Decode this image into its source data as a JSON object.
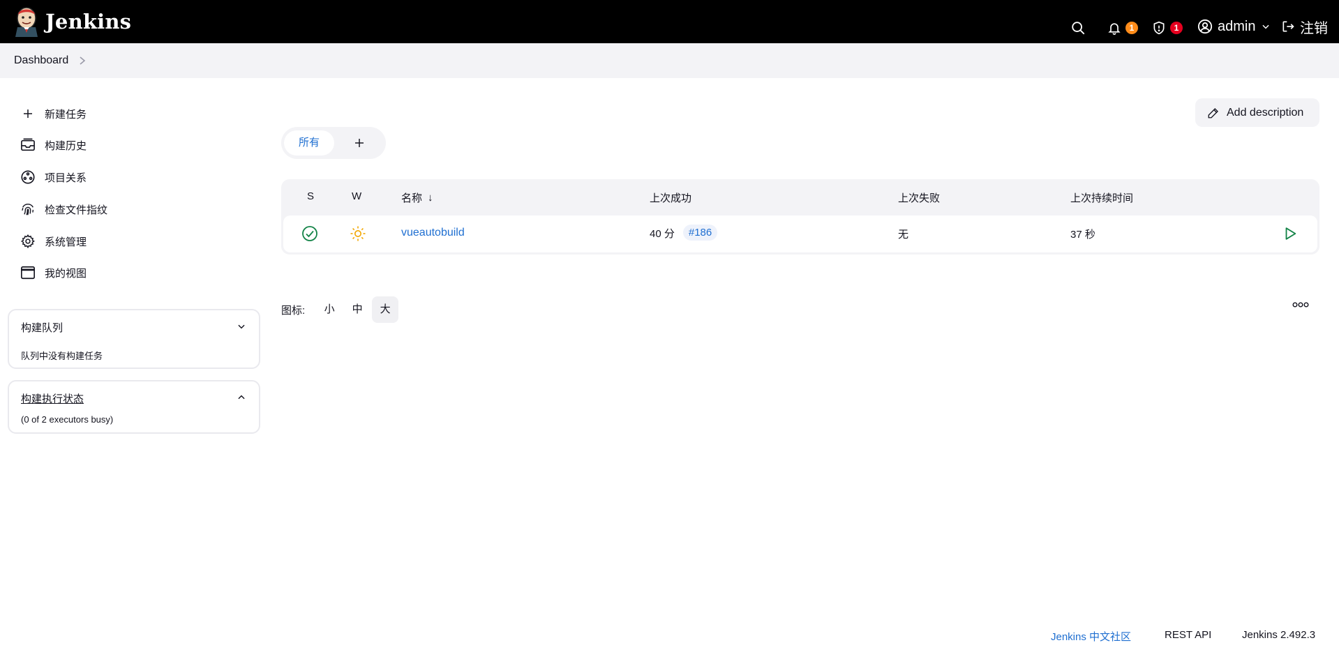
{
  "header": {
    "brand": "Jenkins",
    "notifications_count": "1",
    "security_count": "1",
    "user": "admin",
    "logout_label": "注销"
  },
  "breadcrumb": {
    "items": [
      "Dashboard"
    ]
  },
  "sidebar": {
    "items": [
      {
        "label": "新建任务",
        "icon": "plus-icon"
      },
      {
        "label": "构建历史",
        "icon": "history-icon"
      },
      {
        "label": "项目关系",
        "icon": "relationship-icon"
      },
      {
        "label": "检查文件指纹",
        "icon": "fingerprint-icon"
      },
      {
        "label": "系统管理",
        "icon": "gear-icon"
      },
      {
        "label": "我的视图",
        "icon": "window-icon"
      }
    ],
    "build_queue": {
      "title": "构建队列",
      "empty_text": "队列中没有构建任务"
    },
    "executors": {
      "title": "构建执行状态",
      "status_text": "(0 of 2 executors busy)"
    }
  },
  "main": {
    "add_description_label": "Add description",
    "tabs": [
      {
        "label": "所有"
      }
    ],
    "table": {
      "headers": {
        "s": "S",
        "w": "W",
        "name": "名称",
        "sort_indicator": "↓",
        "last_success": "上次成功",
        "last_failure": "上次失败",
        "last_duration": "上次持续时间"
      },
      "rows": [
        {
          "status": "success",
          "weather": "sunny",
          "name": "vueautobuild",
          "last_success_time": "40 分",
          "last_success_build": "#186",
          "last_failure": "无",
          "last_duration": "37 秒"
        }
      ]
    },
    "icon_size": {
      "label": "图标:",
      "options": [
        "小",
        "中",
        "大"
      ],
      "selected": "大"
    }
  },
  "footer": {
    "community_link": "Jenkins 中文社区",
    "rest_api": "REST API",
    "version": "Jenkins 2.492.3"
  },
  "colors": {
    "header_bg": "#000000",
    "link": "#1f6fd1",
    "success": "#138347",
    "weather": "#f2a600",
    "badge_orange": "#ff8c1a",
    "badge_red": "#e6001f"
  }
}
